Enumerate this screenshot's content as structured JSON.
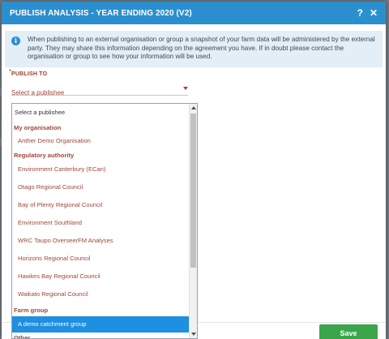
{
  "modal": {
    "title": "PUBLISH ANALYSIS - YEAR ENDING 2020 (V2)",
    "help_glyph": "?",
    "close_glyph": "✕",
    "info_glyph": "i",
    "info_text": "When publishing to an external organisation or group a snapshot of your farm data will be administered by the external party. They may share this information depending on the agreement you have. If in doubt please contact the organisation or group to see how your information will be used.",
    "field_required_mark": "*",
    "field_label": "PUBLISH TO",
    "select_value": "Select a publishee",
    "save_label": "Save"
  },
  "dropdown": {
    "items": [
      {
        "kind": "first",
        "label": "Select a publishee"
      },
      {
        "kind": "group",
        "label": "My organisation"
      },
      {
        "kind": "option",
        "label": "Anther Demo Organisation"
      },
      {
        "kind": "group",
        "label": "Regulatory authority"
      },
      {
        "kind": "option",
        "label": "Environment Canterbury (ECan)"
      },
      {
        "kind": "option",
        "label": "Otago Regional Council"
      },
      {
        "kind": "option",
        "label": "Bay of Plenty Regional Council"
      },
      {
        "kind": "option",
        "label": "Environment Southland"
      },
      {
        "kind": "option",
        "label": "WRC Taupo OverseerFM Analyses"
      },
      {
        "kind": "option",
        "label": "Horizons Regional Council"
      },
      {
        "kind": "option",
        "label": "Hawkes Bay Regional Council"
      },
      {
        "kind": "option",
        "label": "Waikato Regional Council"
      },
      {
        "kind": "group",
        "label": "Farm group"
      },
      {
        "kind": "selected",
        "label": "A demo catchment group"
      },
      {
        "kind": "group",
        "label": "Other"
      }
    ]
  },
  "colors": {
    "header": "#2b8fcf",
    "accent_text": "#a0463a",
    "selected": "#1e8fe1",
    "save": "#3aa54b"
  }
}
